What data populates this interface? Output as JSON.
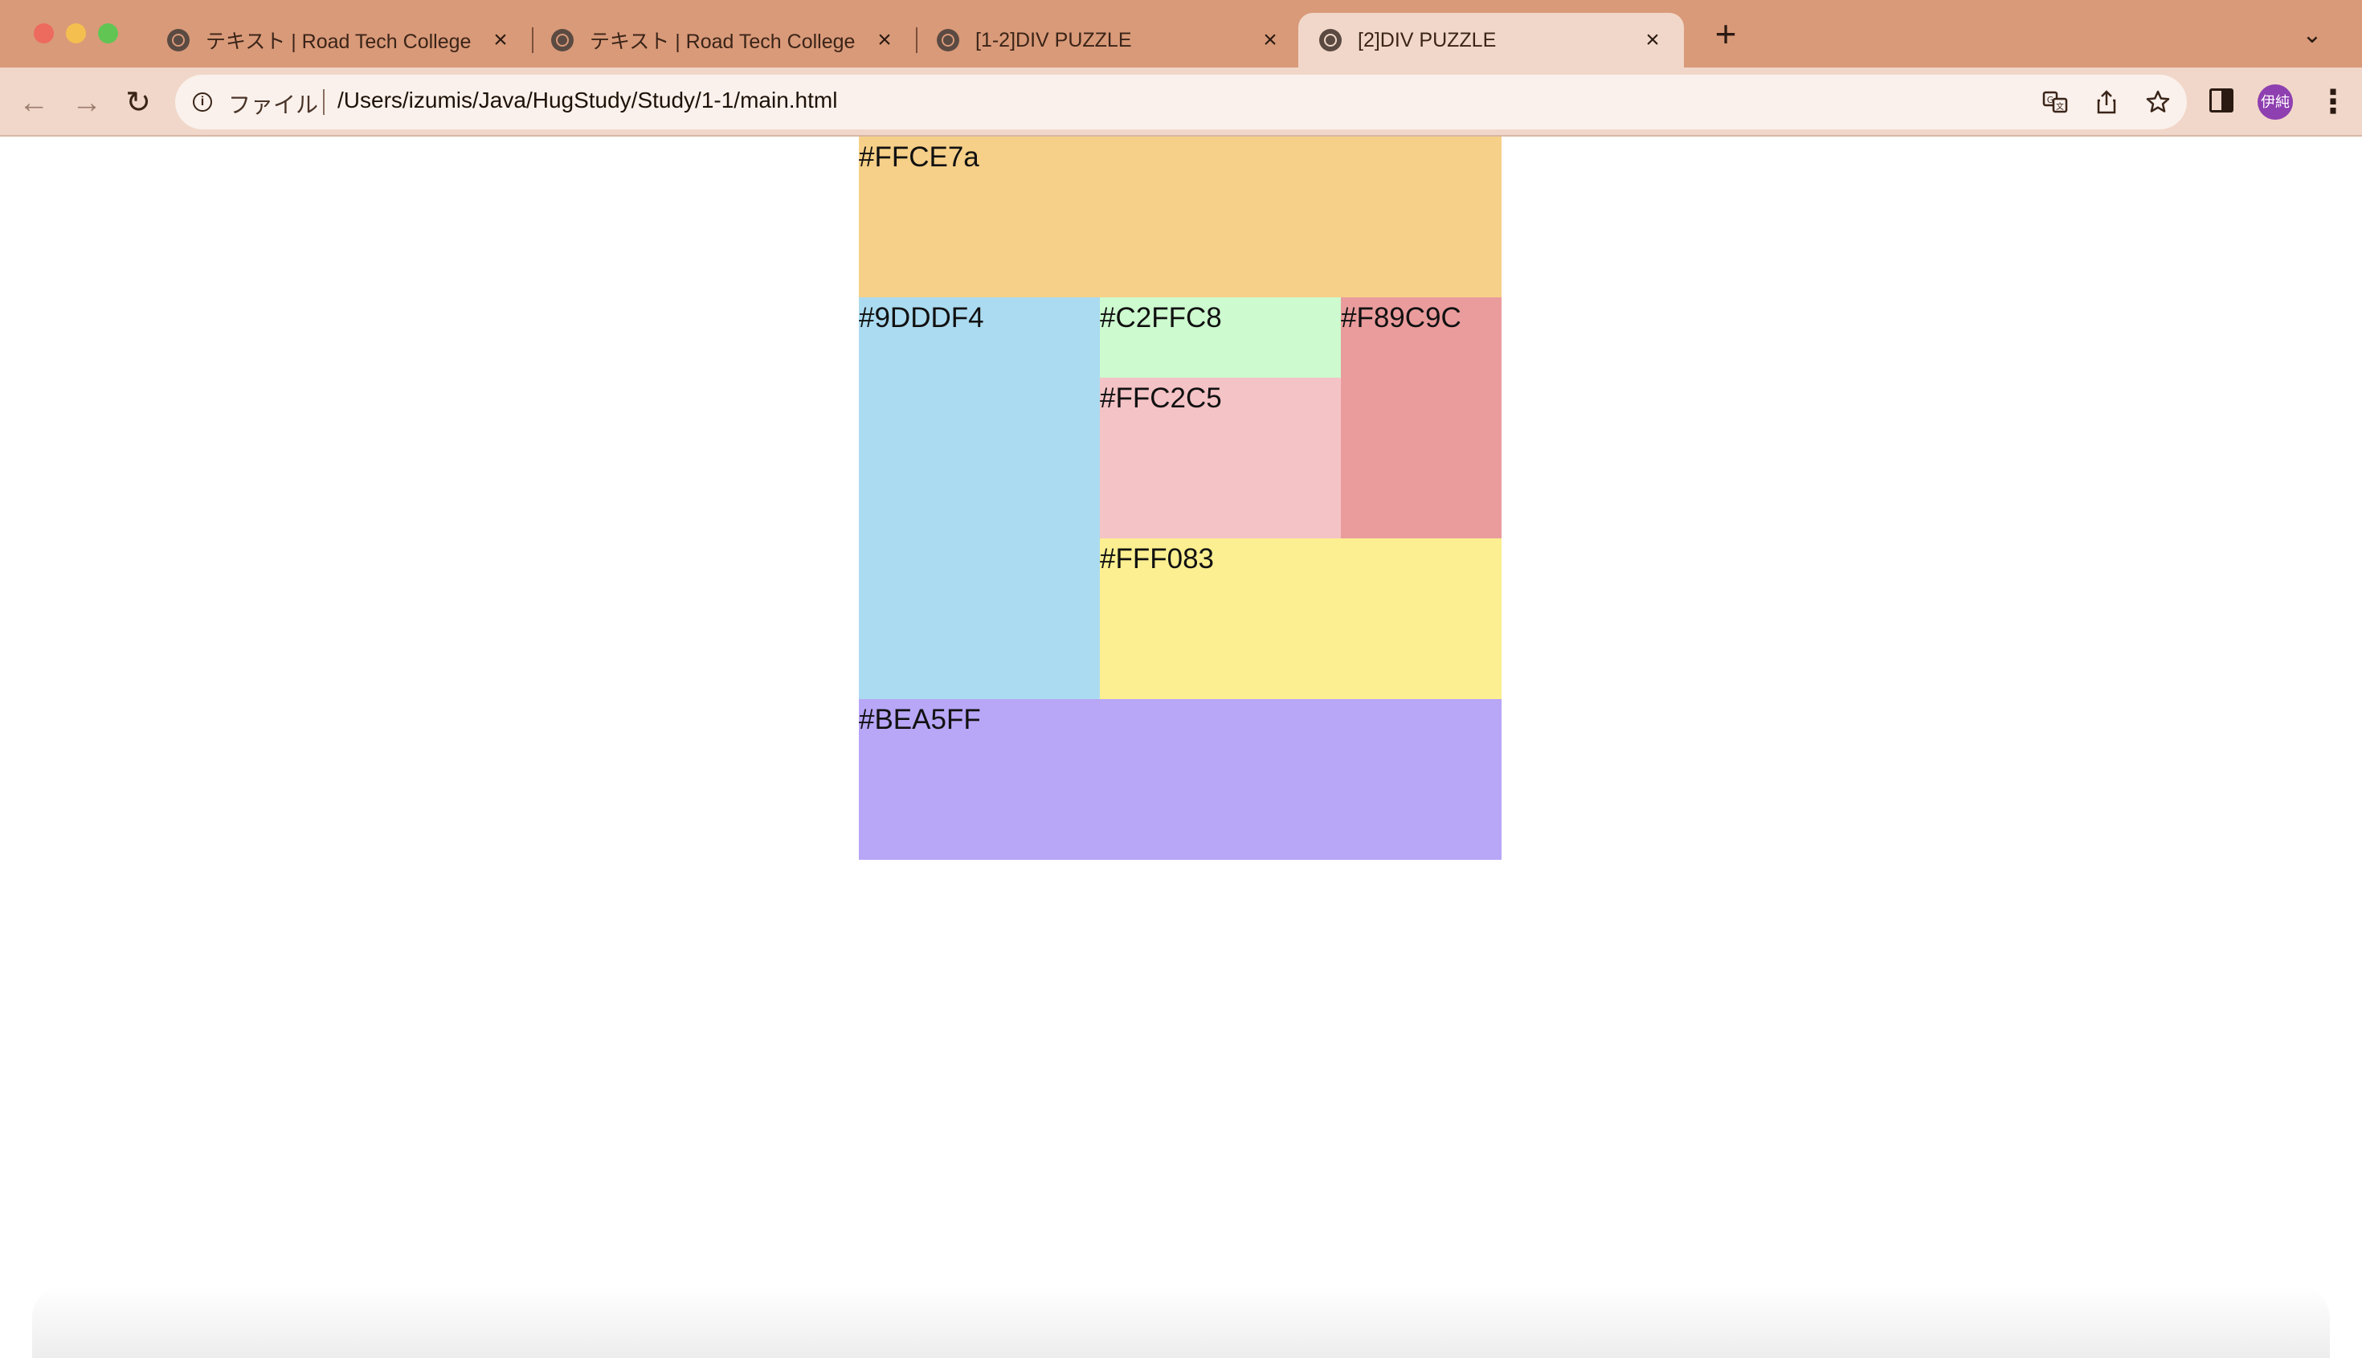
{
  "window": {
    "tabs": [
      {
        "title": "テキスト | Road Tech College",
        "active": false
      },
      {
        "title": "テキスト | Road Tech College",
        "active": false
      },
      {
        "title": "[1-2]DIV PUZZLE",
        "active": false
      },
      {
        "title": "[2]DIV PUZZLE",
        "active": true
      }
    ],
    "new_tab_glyph": "+",
    "tab_list_glyph": "⌄",
    "close_glyph": "×"
  },
  "toolbar": {
    "back_glyph": "←",
    "forward_glyph": "→",
    "reload_glyph": "↻",
    "scheme_label": "ファイル",
    "url": "/Users/izumis/Java/HugStudy/Study/1-1/main.html",
    "avatar_text": "伊純",
    "icons": [
      "info-icon",
      "translate-icon",
      "share-icon",
      "star-icon",
      "side-panel-icon",
      "menu-icon"
    ]
  },
  "puzzle": {
    "top": {
      "label": "#FFCE7a",
      "color": "#F6CF88"
    },
    "left": {
      "label": "#9DDDF4",
      "color": "#ABDBF0"
    },
    "green": {
      "label": "#C2FFC8",
      "color": "#CDFACF"
    },
    "red": {
      "label": "#F89C9C",
      "color": "#EA9C9D"
    },
    "pink": {
      "label": "#FFC2C5",
      "color": "#F4C3C6"
    },
    "yellow": {
      "label": "#FFF083",
      "color": "#FCEF91"
    },
    "bottom": {
      "label": "#BEA5FF",
      "color": "#B8A6F7"
    }
  }
}
